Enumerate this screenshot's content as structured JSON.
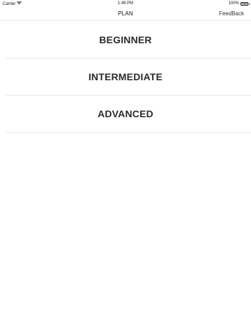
{
  "status_bar": {
    "carrier": "Carrier",
    "wifi_icon": "wifi-icon",
    "time": "1:49 PM",
    "battery_percent": "100%",
    "battery_icon": "battery-icon"
  },
  "nav": {
    "title": "PLAN",
    "right_button_label": "FeedBack"
  },
  "plans": [
    {
      "label": "BEGINNER"
    },
    {
      "label": "INTERMEDIATE"
    },
    {
      "label": "ADVANCED"
    }
  ]
}
